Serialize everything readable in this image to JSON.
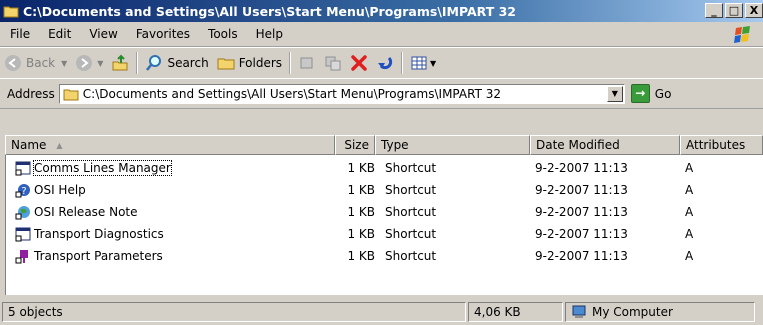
{
  "window": {
    "title": "C:\\Documents and Settings\\All Users\\Start Menu\\Programs\\IMPART 32"
  },
  "winbtns": {
    "minimize": "_",
    "maximize": "□",
    "close": "X"
  },
  "menu": [
    "File",
    "Edit",
    "View",
    "Favorites",
    "Tools",
    "Help"
  ],
  "toolbar": {
    "back": "Back",
    "forward": "",
    "search": "Search",
    "folders": "Folders",
    "views": ""
  },
  "address": {
    "label": "Address",
    "value": "C:\\Documents and Settings\\All Users\\Start Menu\\Programs\\IMPART 32",
    "go": "Go"
  },
  "columns": {
    "name": "Name",
    "size": "Size",
    "type": "Type",
    "date": "Date Modified",
    "attributes": "Attributes"
  },
  "files": [
    {
      "name": "Comms Lines Manager",
      "size": "1 KB",
      "type": "Shortcut",
      "date": "9-2-2007 11:13",
      "attr": "A",
      "icon": "console-shortcut-icon"
    },
    {
      "name": "OSI Help",
      "size": "1 KB",
      "type": "Shortcut",
      "date": "9-2-2007 11:13",
      "attr": "A",
      "icon": "help-shortcut-icon"
    },
    {
      "name": "OSI Release Note",
      "size": "1 KB",
      "type": "Shortcut",
      "date": "9-2-2007 11:13",
      "attr": "A",
      "icon": "globe-shortcut-icon"
    },
    {
      "name": "Transport Diagnostics",
      "size": "1 KB",
      "type": "Shortcut",
      "date": "9-2-2007 11:13",
      "attr": "A",
      "icon": "console-shortcut-icon"
    },
    {
      "name": "Transport Parameters",
      "size": "1 KB",
      "type": "Shortcut",
      "date": "9-2-2007 11:13",
      "attr": "A",
      "icon": "plug-shortcut-icon"
    }
  ],
  "status": {
    "objects": "5 objects",
    "size": "4,06 KB",
    "location": "My Computer"
  }
}
